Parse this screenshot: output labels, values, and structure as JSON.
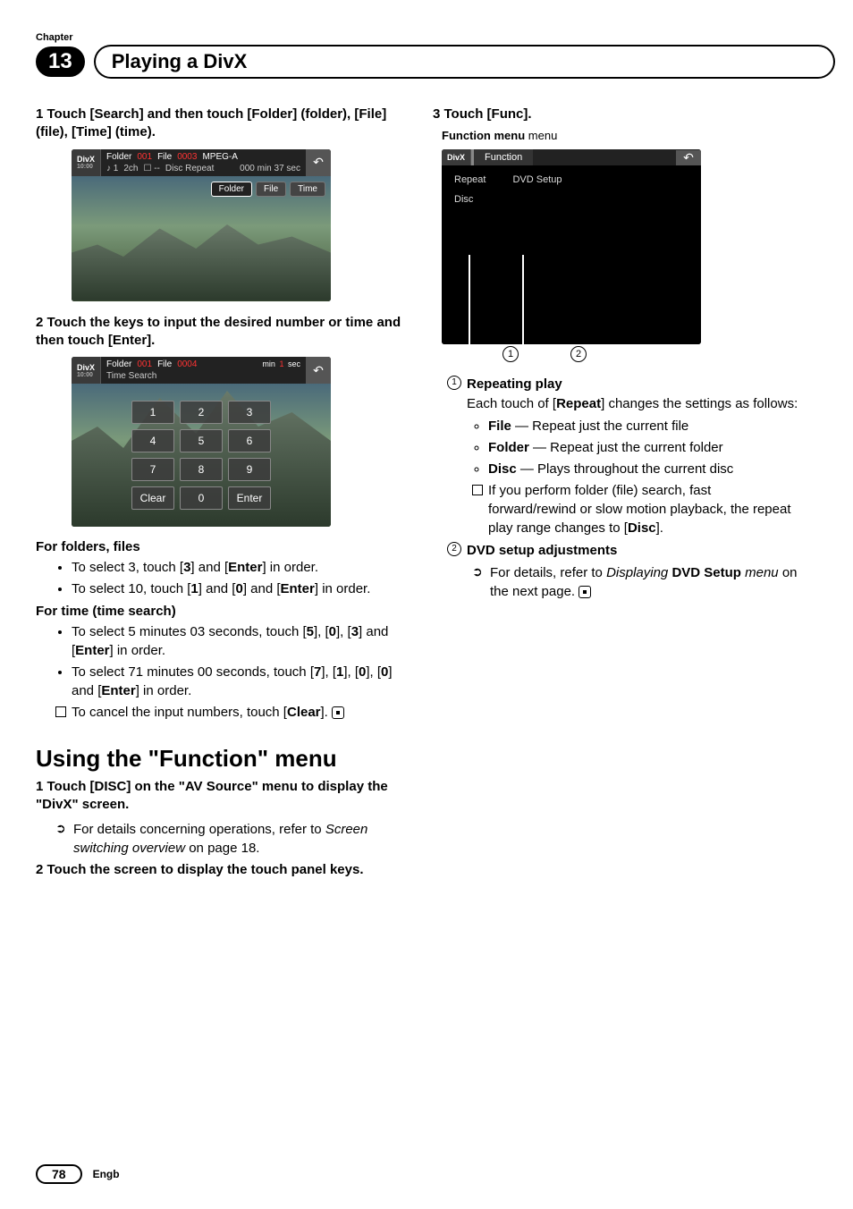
{
  "header": {
    "chapter_label": "Chapter",
    "chapter_number": "13",
    "title": "Playing a DivX"
  },
  "left": {
    "step1": "1     Touch [Search] and then touch [Folder] (folder), [File] (file), [Time] (time).",
    "screen1": {
      "logo_top": "DivX",
      "logo_bottom": "10:00",
      "info_line1_a": "Folder",
      "info_line1_b": "001",
      "info_line1_c": "File",
      "info_line1_d": "0003",
      "info_line1_e": "MPEG-A",
      "info_line2_a": "♪ 1",
      "info_line2_b": "2ch",
      "info_line2_c": "☐ --",
      "info_line2_d": "Disc Repeat",
      "info_line2_e": "000 min 37 sec",
      "btn_folder": "Folder",
      "btn_file": "File",
      "btn_time": "Time"
    },
    "step2": "2     Touch the keys to input the desired number or time and then touch [Enter].",
    "screen2": {
      "logo_top": "DivX",
      "logo_bottom": "10:00",
      "info_line1_a": "Folder",
      "info_line1_b": "001",
      "info_line1_c": "File",
      "info_line1_d": "0004",
      "info_line2": "Time Search",
      "minmark": "min",
      "secmark_num": "1",
      "secmark": "sec",
      "keys": [
        "1",
        "2",
        "3",
        "4",
        "5",
        "6",
        "7",
        "8",
        "9",
        "Clear",
        "0",
        "Enter"
      ]
    },
    "sub_folders": "For folders, files",
    "ff_b1_pre": "To select 3, touch [",
    "ff_b1_k1": "3",
    "ff_b1_mid": "] and [",
    "ff_b1_k2": "Enter",
    "ff_b1_post": "] in order.",
    "ff_b2_pre": "To select 10, touch [",
    "ff_b2_k1": "1",
    "ff_b2_m1": "] and [",
    "ff_b2_k2": "0",
    "ff_b2_m2": "] and [",
    "ff_b2_k3": "Enter",
    "ff_b2_post": "] in order.",
    "sub_time": "For time (time search)",
    "tt_b1_pre": "To select 5 minutes 03 seconds, touch [",
    "tt_b1_k1": "5",
    "tt_b1_m1": "], [",
    "tt_b1_k2": "0",
    "tt_b1_m2": "], [",
    "tt_b1_k3": "3",
    "tt_b1_m3": "] and [",
    "tt_b1_k4": "Enter",
    "tt_b1_post": "] in order.",
    "tt_b2_pre": "To select 71 minutes 00 seconds, touch [",
    "tt_b2_k1": "7",
    "tt_b2_m1": "], [",
    "tt_b2_k2": "1",
    "tt_b2_m2": "], [",
    "tt_b2_k3": "0",
    "tt_b2_m3": "], [",
    "tt_b2_k4": "0",
    "tt_b2_m4": "] and [",
    "tt_b2_k5": "Enter",
    "tt_b2_post": "] in order.",
    "tt_note_pre": "To cancel the input numbers, touch [",
    "tt_note_k": "Clear",
    "tt_note_post": "].",
    "section2_title": "Using the \"Function\" menu",
    "s2_step1": "1     Touch [DISC] on the \"AV Source\" menu to display the \"DivX\" screen.",
    "s2_note1_pre": "For details concerning operations, refer to ",
    "s2_note1_it": "Screen switching overview",
    "s2_note1_post": " on page 18.",
    "s2_step2": "2     Touch the screen to display the touch panel keys."
  },
  "right": {
    "step3": "3     Touch [Func].",
    "caption": "Function menu",
    "screen3": {
      "logo_top": "DivX",
      "title": "Function",
      "item1a": "Repeat",
      "item1b": "Disc",
      "item2": "DVD Setup"
    },
    "callout1": "1",
    "callout2": "2",
    "d1_title": "Repeating play",
    "d1_body_pre": "Each touch of [",
    "d1_body_k": "Repeat",
    "d1_body_post": "] changes the settings as follows:",
    "d1_li1_k": "File",
    "d1_li1_t": " — Repeat just the current file",
    "d1_li2_k": "Folder",
    "d1_li2_t": " — Repeat just the current folder",
    "d1_li3_k": "Disc",
    "d1_li3_t": " — Plays throughout the current disc",
    "d1_note_pre": "If you perform folder (file) search, fast forward/rewind or slow motion playback, the repeat play range changes to [",
    "d1_note_k": "Disc",
    "d1_note_post": "].",
    "d2_title": "DVD setup adjustments",
    "d2_note_pre": "For details, refer to ",
    "d2_note_it": "Displaying ",
    "d2_note_k": "DVD Setup",
    "d2_note_it2": " menu",
    "d2_note_post": " on the next page."
  },
  "footer": {
    "page": "78",
    "lang": "Engb"
  }
}
